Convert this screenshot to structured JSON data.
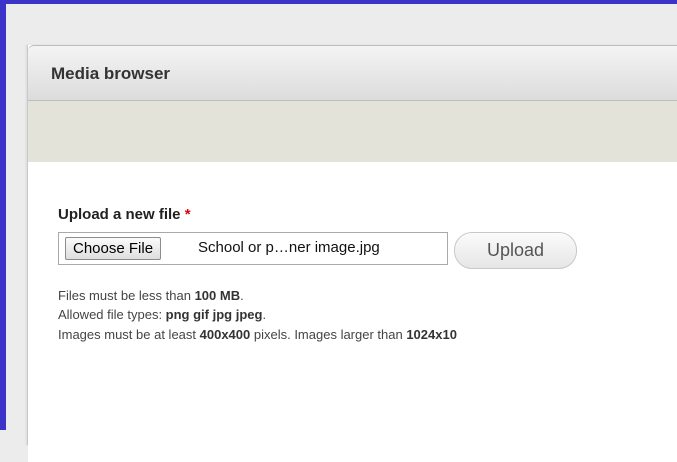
{
  "dialog": {
    "title": "Media browser"
  },
  "upload": {
    "label": "Upload a new file",
    "required_mark": "*",
    "choose_button": "Choose File",
    "file_name": "School or p…ner image.jpg",
    "upload_button": "Upload"
  },
  "help": {
    "size_prefix": "Files must be less than ",
    "size_value": "100 MB",
    "size_suffix": ".",
    "types_prefix": "Allowed file types: ",
    "types_value": "png gif jpg jpeg",
    "types_suffix": ".",
    "images_prefix": "Images must be at least ",
    "images_min": "400x400",
    "images_middle": " pixels. Images larger than ",
    "images_max_partial": "1024x10"
  },
  "colors": {
    "frame": "#3c34c8",
    "required": "#e0000f"
  }
}
